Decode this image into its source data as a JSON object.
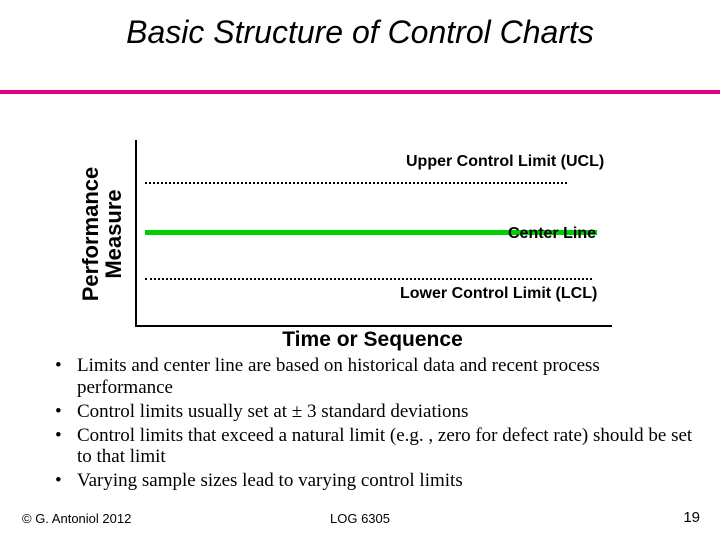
{
  "title": "Basic Structure of Control Charts",
  "axis": {
    "y1": "Performance",
    "y2": "Measure",
    "x": "Time or Sequence"
  },
  "labels": {
    "ucl": "Upper Control Limit (UCL)",
    "center": "Center Line",
    "lcl": "Lower Control Limit (LCL)"
  },
  "bullets": {
    "b0": "Limits and center line are based on historical data and recent process performance",
    "b1": "Control limits usually set at ± 3 standard deviations",
    "b2": "Control limits that exceed a natural limit (e.g. , zero for defect rate) should be set to that limit",
    "b3": "Varying sample sizes lead to varying control limits"
  },
  "footer": {
    "left": "© G. Antoniol 2012",
    "center": "LOG 6305",
    "right": "19"
  },
  "colors": {
    "rule": "#e6007e",
    "centerline": "#00d000"
  },
  "chart_data": {
    "type": "line",
    "title": "Basic Structure of Control Charts",
    "xlabel": "Time or Sequence",
    "ylabel": "Performance Measure",
    "series": [
      {
        "name": "Upper Control Limit (UCL)",
        "style": "dotted",
        "value_description": "mean + 3σ (schematic, horizontal)"
      },
      {
        "name": "Center Line",
        "style": "solid",
        "value_description": "process mean (schematic, horizontal)"
      },
      {
        "name": "Lower Control Limit (LCL)",
        "style": "dotted",
        "value_description": "mean − 3σ (schematic, horizontal)"
      }
    ],
    "note": "Schematic diagram; no numeric axis ticks shown."
  }
}
